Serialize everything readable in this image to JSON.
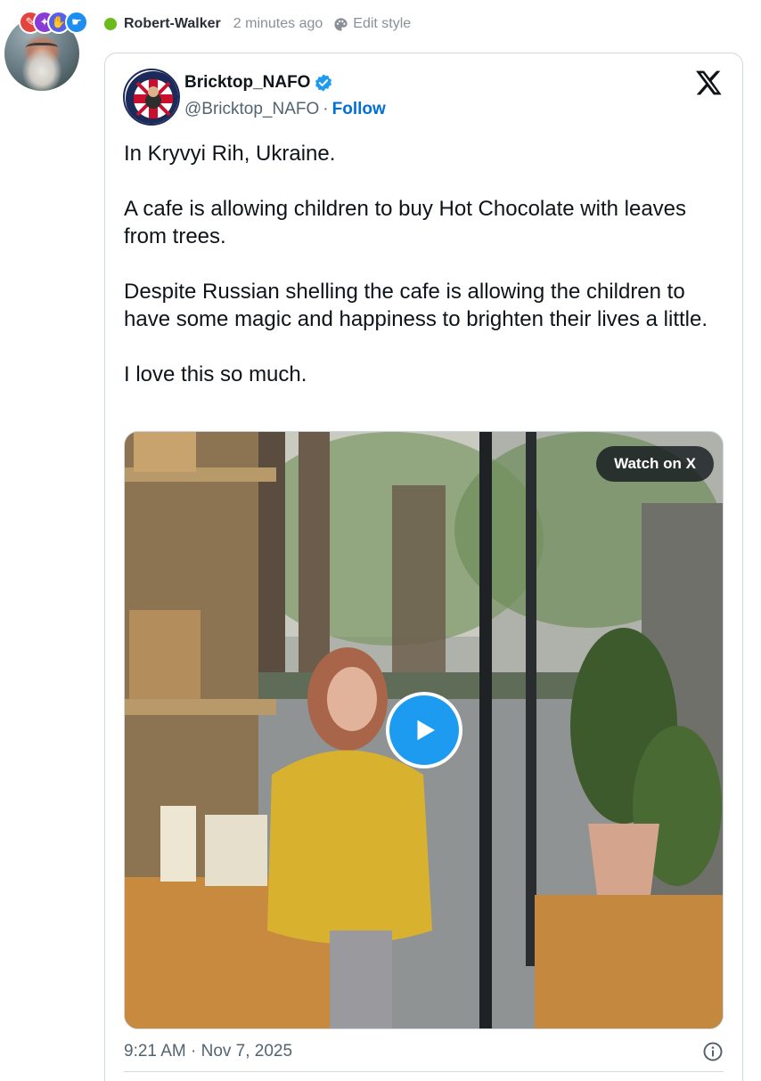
{
  "post": {
    "username": "Robert-Walker",
    "time": "2 minutes ago",
    "edit_style": "Edit style",
    "online_color": "#6cbb1c",
    "avatar_icon": "bearded-man-avatar",
    "badges": [
      {
        "icon": "pen-icon",
        "glyph": "✎",
        "color": "#e4433e"
      },
      {
        "icon": "flame-icon",
        "glyph": "🔥",
        "color": "#8a3bd6"
      },
      {
        "icon": "thumbs-up-icon",
        "glyph": "👍",
        "color": "#5560e8"
      },
      {
        "icon": "handshake-icon",
        "glyph": "🤝",
        "color": "#1d8ef0"
      }
    ]
  },
  "tweet": {
    "author_name": "Bricktop_NAFO",
    "handle": "@Bricktop_NAFO",
    "separator": "·",
    "follow_label": "Follow",
    "paragraphs": [
      "In Kryvyi Rih, Ukraine.",
      "A cafe is allowing children to buy Hot Chocolate with leaves from trees.",
      "Despite Russian shelling the cafe is allowing the children to have some magic and happiness to brighten their lives a little.",
      "I love this so much."
    ],
    "watch_label": "Watch on X",
    "timestamp": "9:21 AM · Nov 7, 2025",
    "accent_color": "#1d9bf0",
    "follow_color": "#006fd6"
  }
}
